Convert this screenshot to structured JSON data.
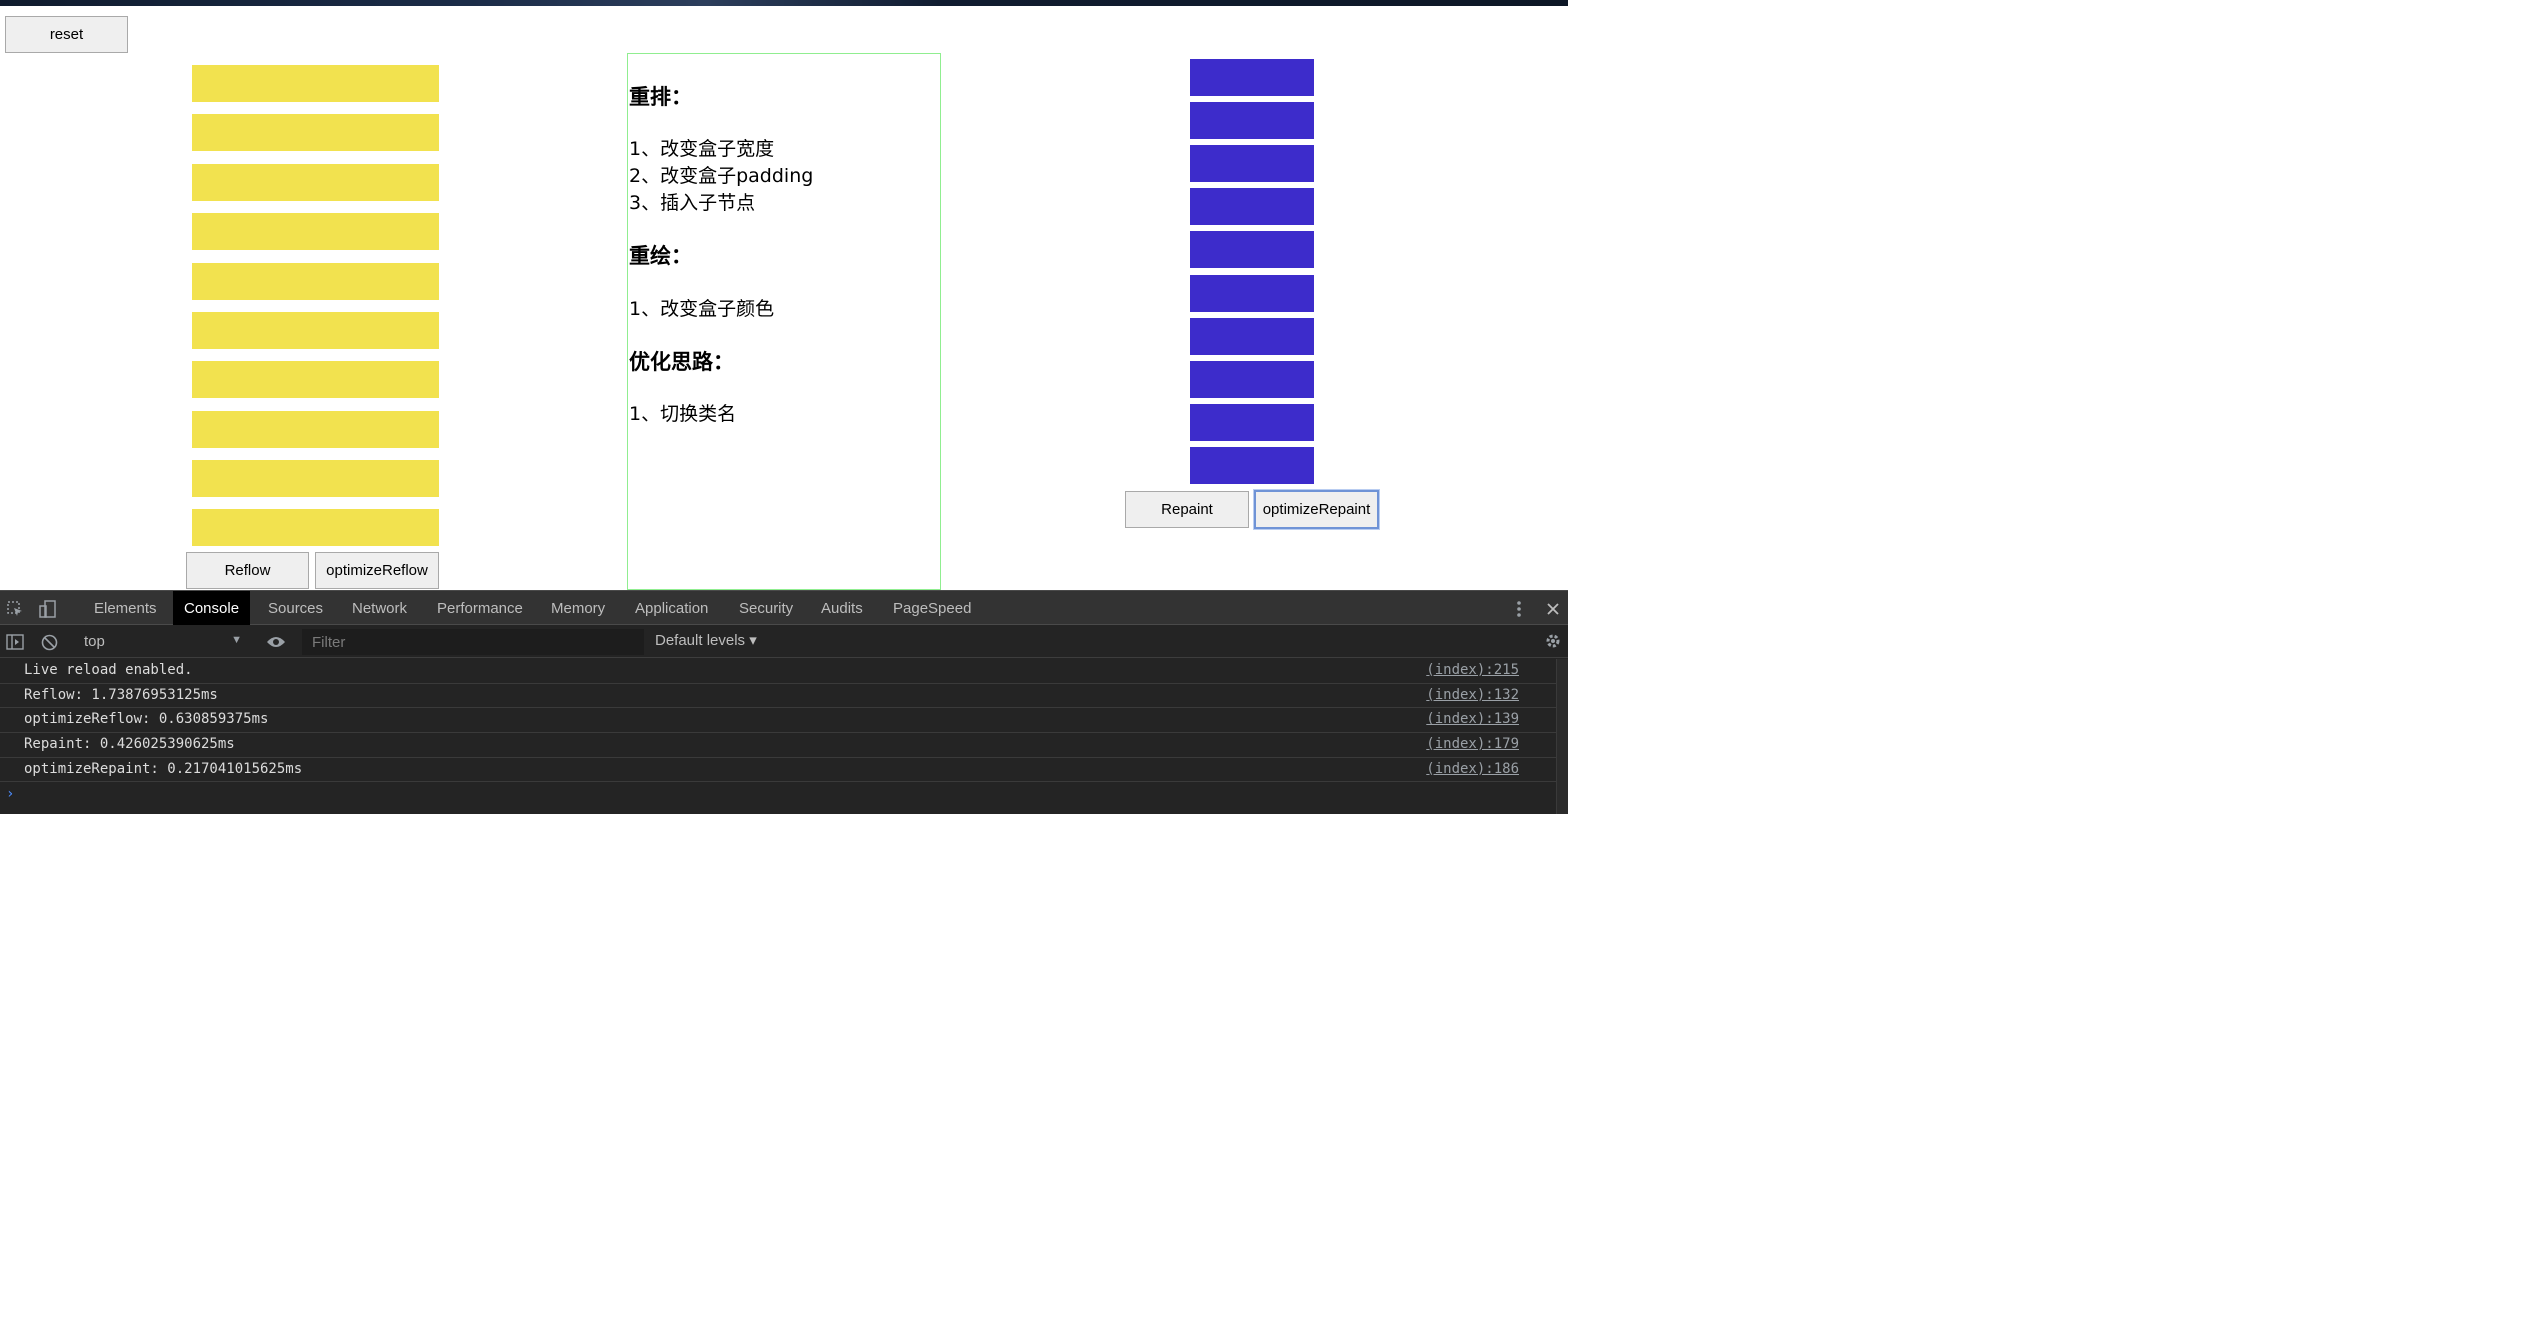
{
  "page": {
    "reset_label": "reset",
    "reflow_label": "Reflow",
    "optimize_reflow_label": "optimizeReflow",
    "repaint_label": "Repaint",
    "optimize_repaint_label": "optimizeRepaint",
    "yellow_box_count": 10,
    "blue_box_count": 10,
    "colors": {
      "yellow_box": "#f2e24f",
      "blue_box": "#3d2ccb",
      "notes_border": "#90ee90"
    }
  },
  "notes": {
    "reflow_heading": "重排：",
    "reflow_items": [
      "1、改变盒子宽度",
      "2、改变盒子padding",
      "3、插入子节点"
    ],
    "repaint_heading": "重绘：",
    "repaint_items": [
      "1、改变盒子颜色"
    ],
    "optimize_heading": "优化思路：",
    "optimize_items": [
      "1、切换类名"
    ]
  },
  "devtools": {
    "tabs": [
      "Elements",
      "Console",
      "Sources",
      "Network",
      "Performance",
      "Memory",
      "Application",
      "Security",
      "Audits",
      "PageSpeed"
    ],
    "active_tab": "Console",
    "context": "top",
    "filter_placeholder": "Filter",
    "levels_label": "Default levels ▾",
    "icons": [
      "inspect-element-icon",
      "device-toolbar-icon",
      "more-options-icon",
      "close-icon",
      "sidebar-toggle-icon",
      "clear-console-icon",
      "eye-icon",
      "settings-icon"
    ],
    "logs": [
      {
        "message": "Live reload enabled.",
        "source": "(index):215"
      },
      {
        "message": "Reflow: 1.73876953125ms",
        "source": "(index):132"
      },
      {
        "message": "optimizeReflow: 0.630859375ms",
        "source": "(index):139"
      },
      {
        "message": "Repaint: 0.426025390625ms",
        "source": "(index):179"
      },
      {
        "message": "optimizeRepaint: 0.217041015625ms",
        "source": "(index):186"
      }
    ],
    "prompt_symbol": "›"
  }
}
